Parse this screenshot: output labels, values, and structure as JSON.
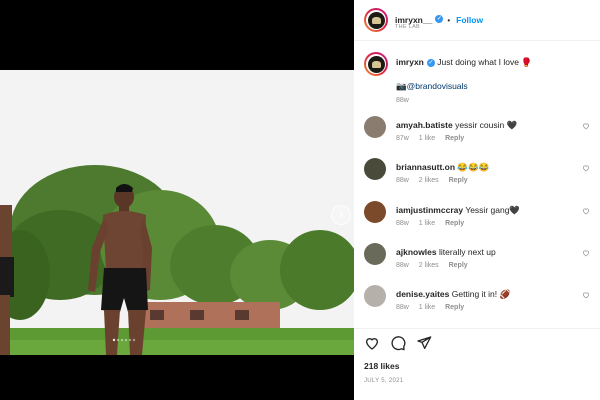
{
  "header": {
    "username": "imryxn__",
    "follow_label": "Follow",
    "dot": "•",
    "sub_label": "THE LAB"
  },
  "caption": {
    "username": "imryxn",
    "text": "Just doing what I love 🥊",
    "mention_prefix": "📷",
    "mention": "@brandovisuals",
    "age": "88w"
  },
  "comments": [
    {
      "username": "amyah.batiste",
      "text": "yessir cousin 🖤",
      "age": "87w",
      "likes": "1 like",
      "reply": "Reply",
      "avatar_color": "#8a7d70"
    },
    {
      "username": "briannasutt.on",
      "text": "😂😂😂",
      "age": "88w",
      "likes": "2 likes",
      "reply": "Reply",
      "avatar_color": "#4a4a3a"
    },
    {
      "username": "iamjustinmccray",
      "text": "Yessir gang🖤",
      "age": "88w",
      "likes": "1 like",
      "reply": "Reply",
      "avatar_color": "#7a4a2a"
    },
    {
      "username": "ajknowles",
      "text": "lite​rally next up",
      "age": "88w",
      "likes": "2 likes",
      "reply": "Reply",
      "avatar_color": "#6a6a5a"
    },
    {
      "username": "denise.yaites",
      "text": "Getting it in! 🏈",
      "age": "88w",
      "likes": "1 like",
      "reply": "Reply",
      "avatar_color": "#b5b0aa"
    }
  ],
  "actions": {
    "likes": "218 likes",
    "date": "JULY 5, 2021"
  },
  "colors": {
    "verified": "#3897f0",
    "follow": "#0095f6",
    "muted": "#8e8e8e"
  }
}
